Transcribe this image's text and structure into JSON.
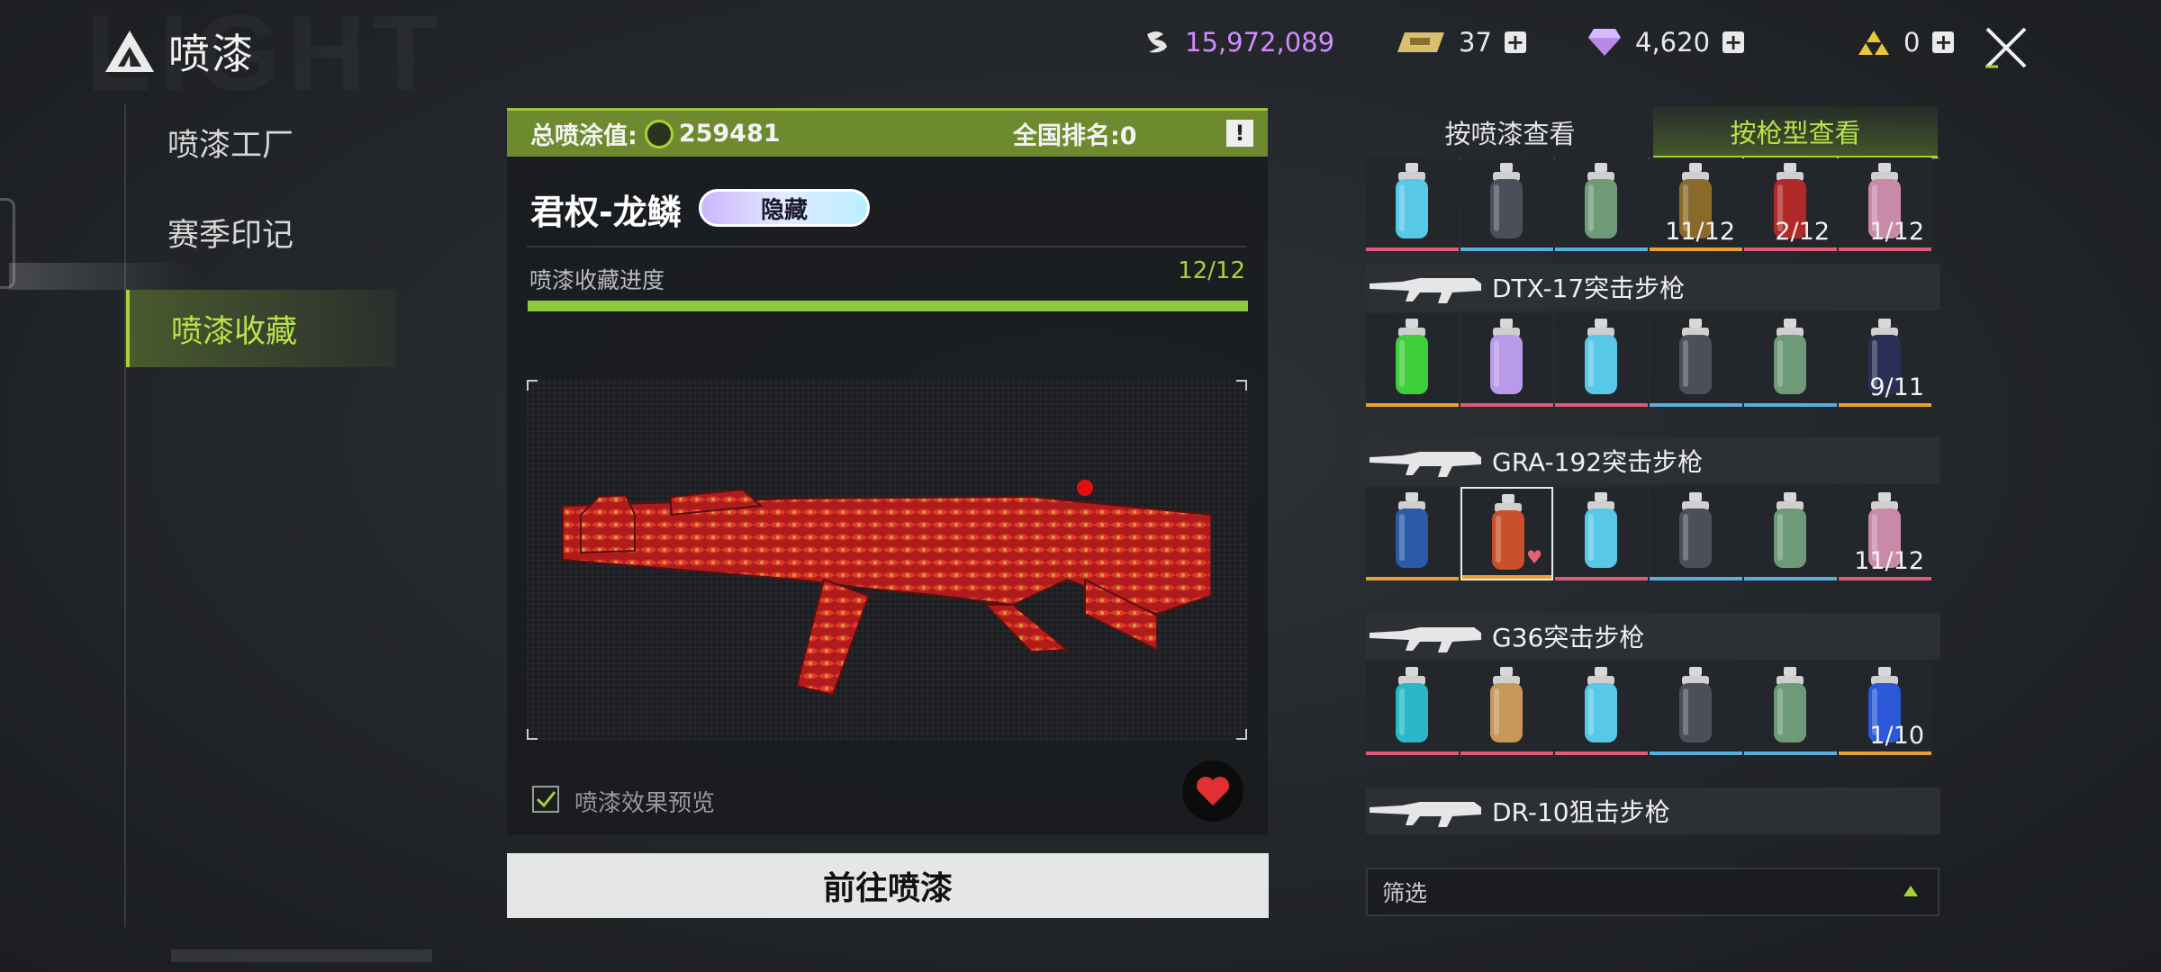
{
  "header": {
    "title": "喷漆",
    "watermark": "LIGHT"
  },
  "currencies": [
    {
      "icon": "silver-coin-icon",
      "value": "15,972,089",
      "color": "#d08cff"
    },
    {
      "icon": "gold-ticket-icon",
      "value": "37",
      "color": "#f0f0f0"
    },
    {
      "icon": "diamond-icon",
      "value": "4,620",
      "color": "#f0f0f0"
    },
    {
      "icon": "triforce-icon",
      "value": "0",
      "color": "#f0f0f0"
    }
  ],
  "sidebar": {
    "items": [
      {
        "label": "喷漆工厂"
      },
      {
        "label": "赛季印记"
      },
      {
        "label": "喷漆收藏"
      }
    ]
  },
  "panel": {
    "total_label": "总喷涂值:",
    "total_value": "259481",
    "rank_label": "全国排名:0",
    "info": "!",
    "skin_name": "君权-龙鳞",
    "badge": "隐藏",
    "progress_label": "喷漆收藏进度",
    "progress_value": "12/12",
    "progress_fraction": 1.0,
    "preview_label": "喷漆效果预览",
    "go_button": "前往喷漆"
  },
  "tabs": [
    {
      "label": "按喷漆查看"
    },
    {
      "label": "按枪型查看"
    }
  ],
  "guns": [
    {
      "name": "",
      "cans": [
        {
          "color": "#58c8e8",
          "underline": "#e05a7a",
          "count": ""
        },
        {
          "color": "#4a4f5a",
          "underline": "#58aee0",
          "count": ""
        },
        {
          "color": "#6f9a78",
          "underline": "#58aee0",
          "count": ""
        },
        {
          "color": "#8a6a2a",
          "underline": "#e8a030",
          "count": "11/12"
        },
        {
          "color": "#b02828",
          "underline": "#e05a7a",
          "count": "2/12"
        },
        {
          "color": "#c88aa8",
          "underline": "#e05a7a",
          "count": "1/12"
        }
      ]
    },
    {
      "name": "DTX-17突击步枪",
      "cans": [
        {
          "color": "#3fcf3a",
          "underline": "#e8a030",
          "count": ""
        },
        {
          "color": "#b89ae8",
          "underline": "#e05a7a",
          "count": ""
        },
        {
          "color": "#58c8e8",
          "underline": "#e05a7a",
          "count": ""
        },
        {
          "color": "#4a4f5a",
          "underline": "#58aee0",
          "count": ""
        },
        {
          "color": "#6f9a78",
          "underline": "#58aee0",
          "count": ""
        },
        {
          "color": "#2a2f55",
          "underline": "#e8a030",
          "count": "9/11"
        }
      ]
    },
    {
      "name": "GRA-192突击步枪",
      "cans": [
        {
          "color": "#2a5aa8",
          "underline": "#e8a030",
          "count": ""
        },
        {
          "color": "#c8502a",
          "underline": "#e8a030",
          "count": "",
          "selected": true,
          "heart": true
        },
        {
          "color": "#58c8e8",
          "underline": "#e05a7a",
          "count": ""
        },
        {
          "color": "#4a4f5a",
          "underline": "#58aee0",
          "count": ""
        },
        {
          "color": "#6f9a78",
          "underline": "#58aee0",
          "count": ""
        },
        {
          "color": "#c88aa8",
          "underline": "#e05a7a",
          "count": "11/12"
        }
      ]
    },
    {
      "name": "G36突击步枪",
      "cans": [
        {
          "color": "#2ab8c8",
          "underline": "#e05a7a",
          "count": ""
        },
        {
          "color": "#c89858",
          "underline": "#e05a7a",
          "count": ""
        },
        {
          "color": "#58c8e8",
          "underline": "#e05a7a",
          "count": ""
        },
        {
          "color": "#4a4f5a",
          "underline": "#58aee0",
          "count": ""
        },
        {
          "color": "#6f9a78",
          "underline": "#58aee0",
          "count": ""
        },
        {
          "color": "#2a58d8",
          "underline": "#e8a030",
          "count": "1/10"
        }
      ]
    },
    {
      "name": "DR-10狙击步枪",
      "cans": []
    }
  ],
  "filter": {
    "label": "筛选"
  },
  "colors": {
    "accent": "#a8d234",
    "bar": "#6e8a2e"
  }
}
